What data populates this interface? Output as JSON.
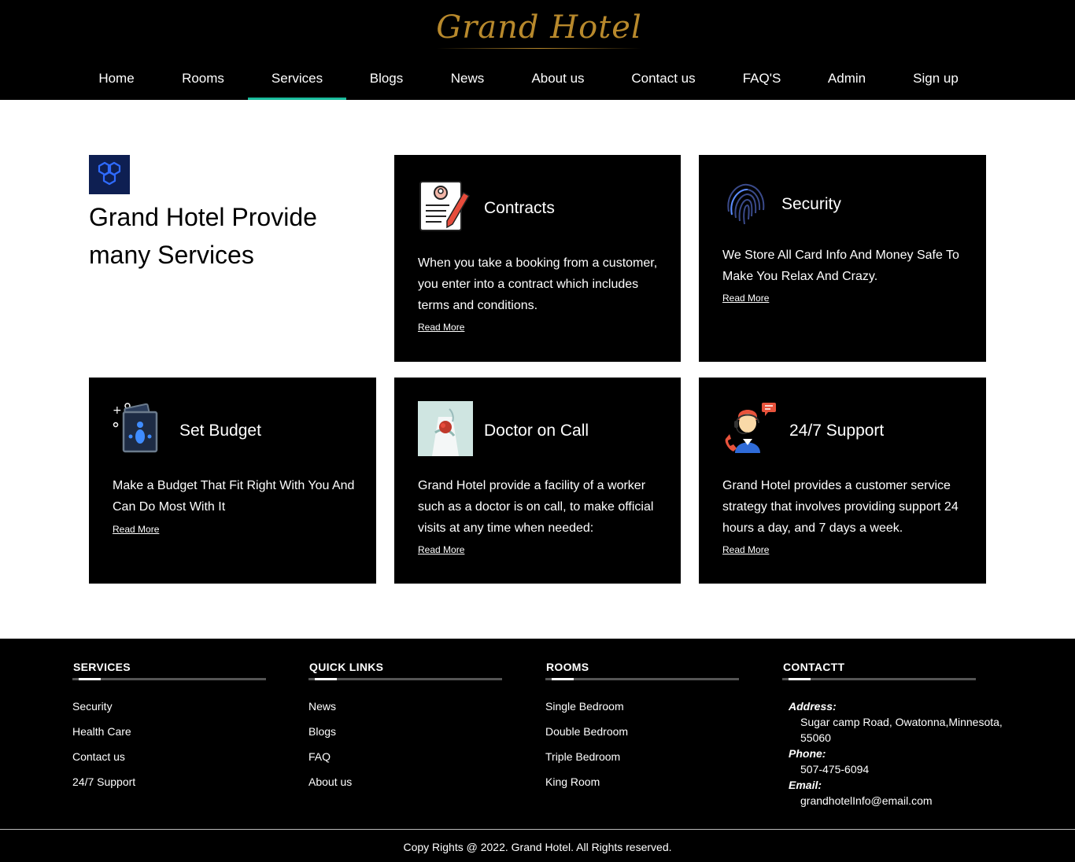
{
  "brand": {
    "logo": "Grand Hotel"
  },
  "nav": {
    "items": [
      {
        "label": "Home"
      },
      {
        "label": "Rooms"
      },
      {
        "label": "Services"
      },
      {
        "label": "Blogs"
      },
      {
        "label": "News"
      },
      {
        "label": "About us"
      },
      {
        "label": "Contact us"
      },
      {
        "label": "FAQ'S"
      },
      {
        "label": "Admin"
      },
      {
        "label": "Sign up"
      }
    ],
    "active": "Services",
    "active_color": "#1abc9c"
  },
  "intro": {
    "title": "Grand Hotel Provide many Services",
    "icon": "cubes-icon"
  },
  "services": [
    {
      "title": "Contracts",
      "icon": "contract-icon",
      "desc": "When you take a booking from a customer, you enter into a contract which includes terms and conditions.",
      "link": "Read More"
    },
    {
      "title": "Security",
      "icon": "fingerprint-icon",
      "desc": "We Store All Card Info And Money Safe To Make You Relax And Crazy.",
      "link": "Read More"
    },
    {
      "title": "Set Budget",
      "icon": "money-icon",
      "desc": "Make a Budget That Fit Right With You And Can Do Most With It",
      "link": "Read More"
    },
    {
      "title": "Doctor on Call",
      "icon": "doctor-photo",
      "desc": "Grand Hotel provide a facility of a worker such as a doctor is on call, to make official visits at any time when needed:",
      "link": "Read More"
    },
    {
      "title": "24/7 Support",
      "icon": "support-agent-icon",
      "desc": "Grand Hotel provides a customer service strategy that involves providing support 24 hours a day, and 7 days a week.",
      "link": "Read More"
    }
  ],
  "footer": {
    "services": {
      "heading": "SERVICES",
      "links": [
        "Security",
        "Health Care",
        "Contact us",
        "24/7 Support"
      ]
    },
    "quick_links": {
      "heading": "QUICK LINKS",
      "links": [
        "News",
        "Blogs",
        "FAQ",
        "About us"
      ]
    },
    "rooms": {
      "heading": "ROOMS",
      "links": [
        "Single Bedroom",
        "Double Bedroom",
        "Triple Bedroom",
        "King Room"
      ]
    },
    "contact": {
      "heading": "CONTACTT",
      "address_label": "Address:",
      "address_line1": "Sugar camp Road, Owatonna,Minnesota,",
      "address_line2": "55060",
      "phone_label": "Phone:",
      "phone": "507-475-6094",
      "email_label": "Email:",
      "email": "grandhotelInfo@email.com"
    },
    "copyright": "Copy Rights @ 2022. Grand Hotel. All Rights reserved."
  }
}
